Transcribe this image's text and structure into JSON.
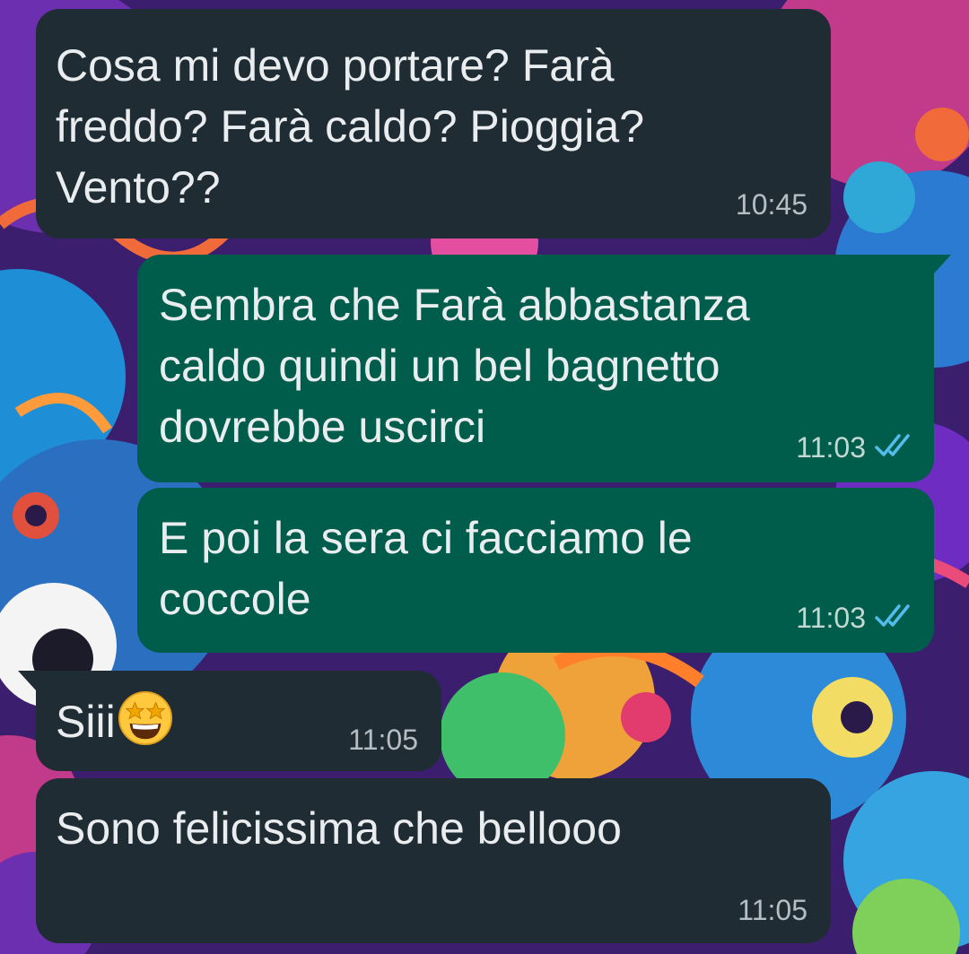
{
  "messages": [
    {
      "direction": "incoming",
      "text": "Cosa mi devo portare? Farà\nfreddo? Farà caldo? Pioggia?\nVento??",
      "time": "10:45"
    },
    {
      "direction": "outgoing",
      "text": "Sembra che Farà abbastanza\ncaldo quindi un bel bagnetto\ndovrebbe uscirci",
      "time": "11:03",
      "status_icon": "double-check-read-icon",
      "status_color": "#53bdeb"
    },
    {
      "direction": "outgoing",
      "text": "E poi la sera ci facciamo le\ncoccole",
      "time": "11:03",
      "status_icon": "double-check-read-icon",
      "status_color": "#53bdeb"
    },
    {
      "direction": "incoming",
      "text": "Siii",
      "emoji_icon": "star-struck-emoji-icon",
      "time": "11:05"
    },
    {
      "direction": "incoming",
      "text": "Sono felicissima che bellooo",
      "time": "11:05"
    }
  ],
  "colors": {
    "incoming_bubble": "#202c33",
    "outgoing_bubble": "#005c4b",
    "message_text": "#e9edef",
    "timestamp": "#b5bec4",
    "read_ticks": "#53bdeb"
  }
}
